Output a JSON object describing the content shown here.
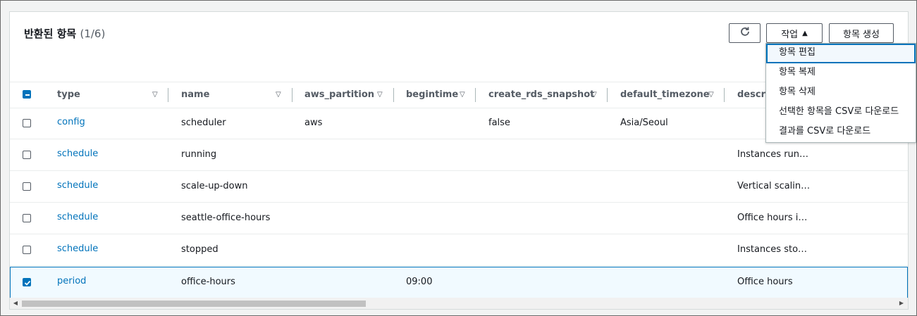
{
  "panel": {
    "title": "반환된 항목",
    "count": "(1/6)"
  },
  "buttons": {
    "actions_label": "작업",
    "create_label": "항목 생성"
  },
  "columns": [
    "type",
    "name",
    "aws_partition",
    "begintime",
    "create_rds_snapshot",
    "default_timezone",
    "descrip"
  ],
  "rows": [
    {
      "type": "config",
      "name": "scheduler",
      "aws_partition": "aws",
      "begintime": "",
      "create_rds_snapshot": "false",
      "default_timezone": "Asia/Seoul",
      "description": "",
      "checked": false
    },
    {
      "type": "schedule",
      "name": "running",
      "aws_partition": "",
      "begintime": "",
      "create_rds_snapshot": "",
      "default_timezone": "",
      "description": "Instances run…",
      "checked": false
    },
    {
      "type": "schedule",
      "name": "scale-up-down",
      "aws_partition": "",
      "begintime": "",
      "create_rds_snapshot": "",
      "default_timezone": "",
      "description": "Vertical scalin…",
      "checked": false
    },
    {
      "type": "schedule",
      "name": "seattle-office-hours",
      "aws_partition": "",
      "begintime": "",
      "create_rds_snapshot": "",
      "default_timezone": "",
      "description": "Office hours i…",
      "checked": false
    },
    {
      "type": "schedule",
      "name": "stopped",
      "aws_partition": "",
      "begintime": "",
      "create_rds_snapshot": "",
      "default_timezone": "",
      "description": "Instances sto…",
      "checked": false
    },
    {
      "type": "period",
      "name": "office-hours",
      "aws_partition": "",
      "begintime": "09:00",
      "create_rds_snapshot": "",
      "default_timezone": "",
      "description": "Office hours",
      "checked": true
    }
  ],
  "menu": {
    "items": [
      "항목 편집",
      "항목 복제",
      "항목 삭제",
      "선택한 항목을 CSV로 다운로드",
      "결과를 CSV로 다운로드"
    ],
    "active_index": 0
  },
  "colors": {
    "accent": "#0073bb",
    "link": "#0073bb",
    "border": "#545b64"
  }
}
